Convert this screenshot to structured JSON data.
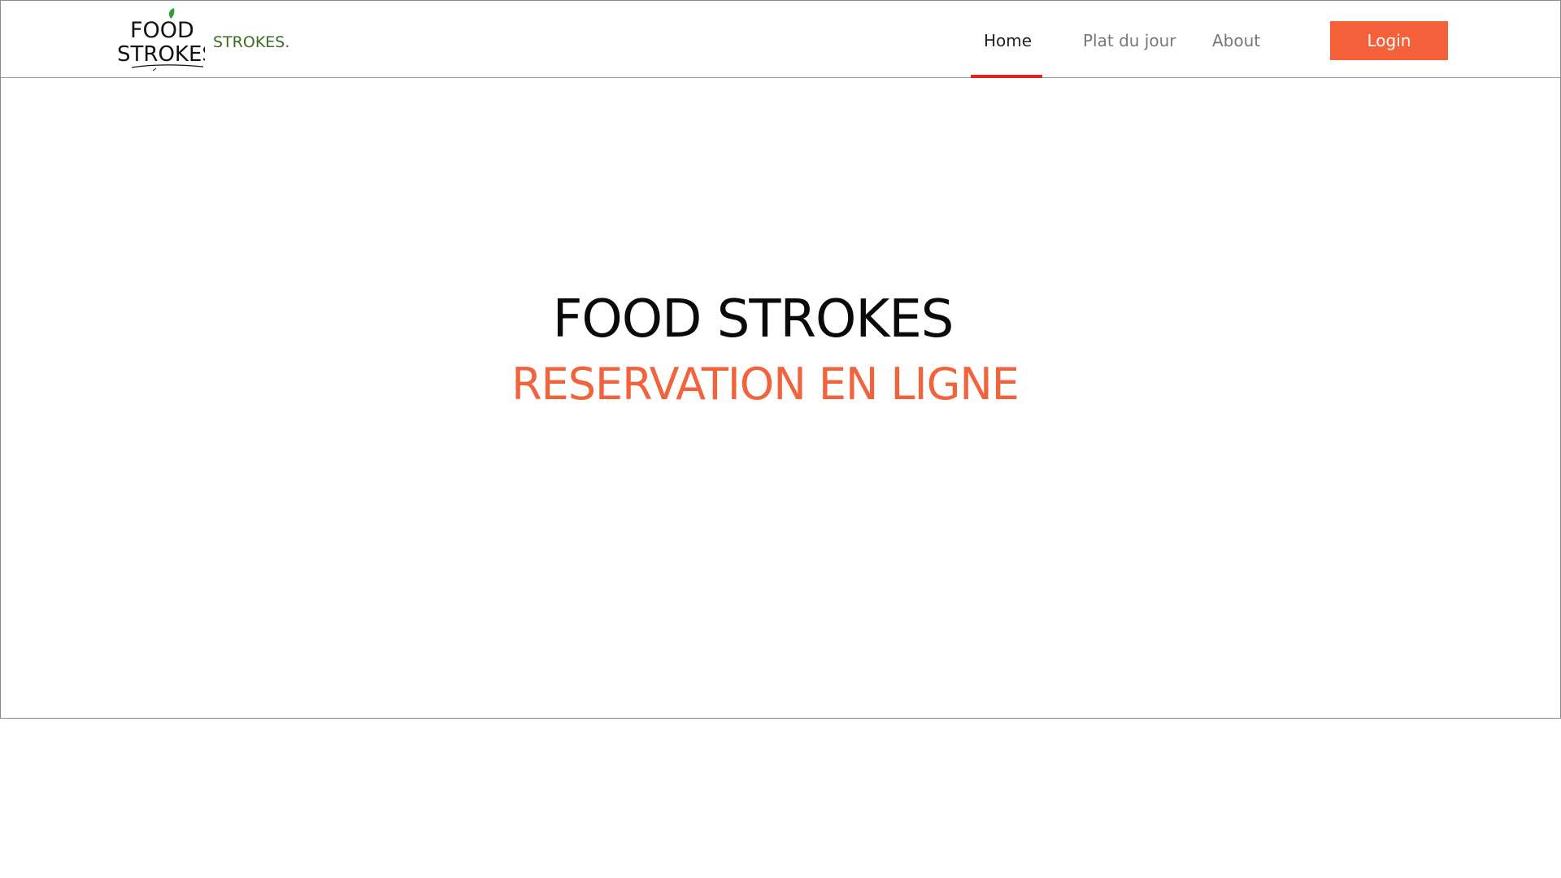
{
  "brand": {
    "logo_text_top": "FOOD",
    "logo_text_bottom": "STROKES.",
    "name": "STROKES."
  },
  "nav": {
    "items": [
      {
        "label": "Home",
        "active": true
      },
      {
        "label": "Plat du jour",
        "active": false
      },
      {
        "label": "About",
        "active": false
      }
    ],
    "login_label": "Login"
  },
  "hero": {
    "title": "FOOD STROKES",
    "subtitle": "RESERVATION EN LIGNE"
  },
  "colors": {
    "accent": "#f4603a",
    "active_underline": "#e8231e",
    "brand_green": "#3d6b22",
    "leaf_green": "#2e9e3a"
  },
  "icons": {
    "logo": "food-strokes-logo-icon"
  }
}
